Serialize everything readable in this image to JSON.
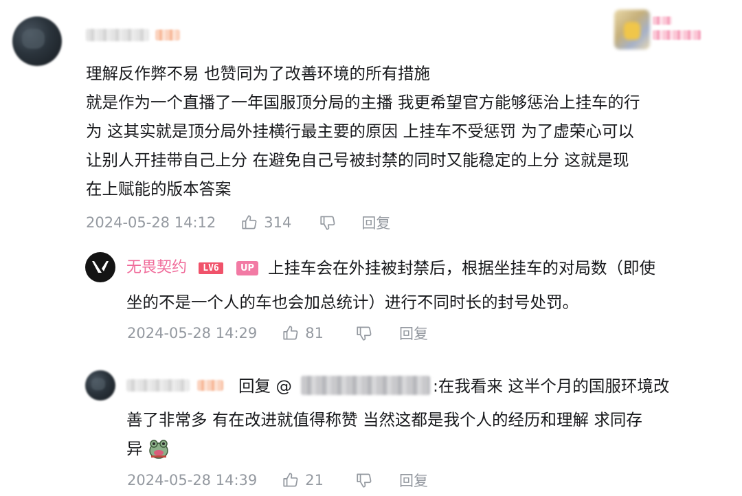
{
  "colors": {
    "text": "#18191c",
    "meta": "#9499a0",
    "brand_pink": "#f06b9a",
    "level_badge": "#f0526a",
    "up_badge": "#f27aa4"
  },
  "main_comment": {
    "lines": [
      "理解反作弊不易 也赞同为了改善环境的所有措施",
      "就是作为一个直播了一年国服顶分局的主播 我更希望官方能够惩治上挂车的行",
      "为 这其实就是顶分局外挂横行最主要的原因 上挂车不受惩罚 为了虚荣心可以",
      "让别人开挂带自己上分 在避免自己号被封禁的同时又能稳定的上分 这就是现",
      "在上赋能的版本答案"
    ],
    "time": "2024-05-28 14:12",
    "likes": "314",
    "reply_label": "回复"
  },
  "reply1": {
    "username": "无畏契约",
    "level": "LV6",
    "up_badge": "UP",
    "lines": [
      "上挂车会在外挂被封禁后，根据坐挂车的对局数（即使",
      "坐的不是一个人的车也会加总统计）进行不同时长的封号处罚。"
    ],
    "time": "2024-05-28 14:29",
    "likes": "81",
    "reply_label": "回复"
  },
  "reply2": {
    "prefix": "回复 @",
    "after_mention": ":在我看来 这半个月的国服环境改",
    "lines": [
      "善了非常多 有在改进就值得称赞 当然这都是我个人的经历和理解 求同存",
      "异"
    ],
    "time": "2024-05-28 14:39",
    "likes": "21",
    "reply_label": "回复"
  },
  "icons": [
    "like-icon",
    "dislike-icon",
    "user-avatar",
    "valorant-logo-icon",
    "frog-emoji-icon",
    "fan-medal-pendant"
  ]
}
